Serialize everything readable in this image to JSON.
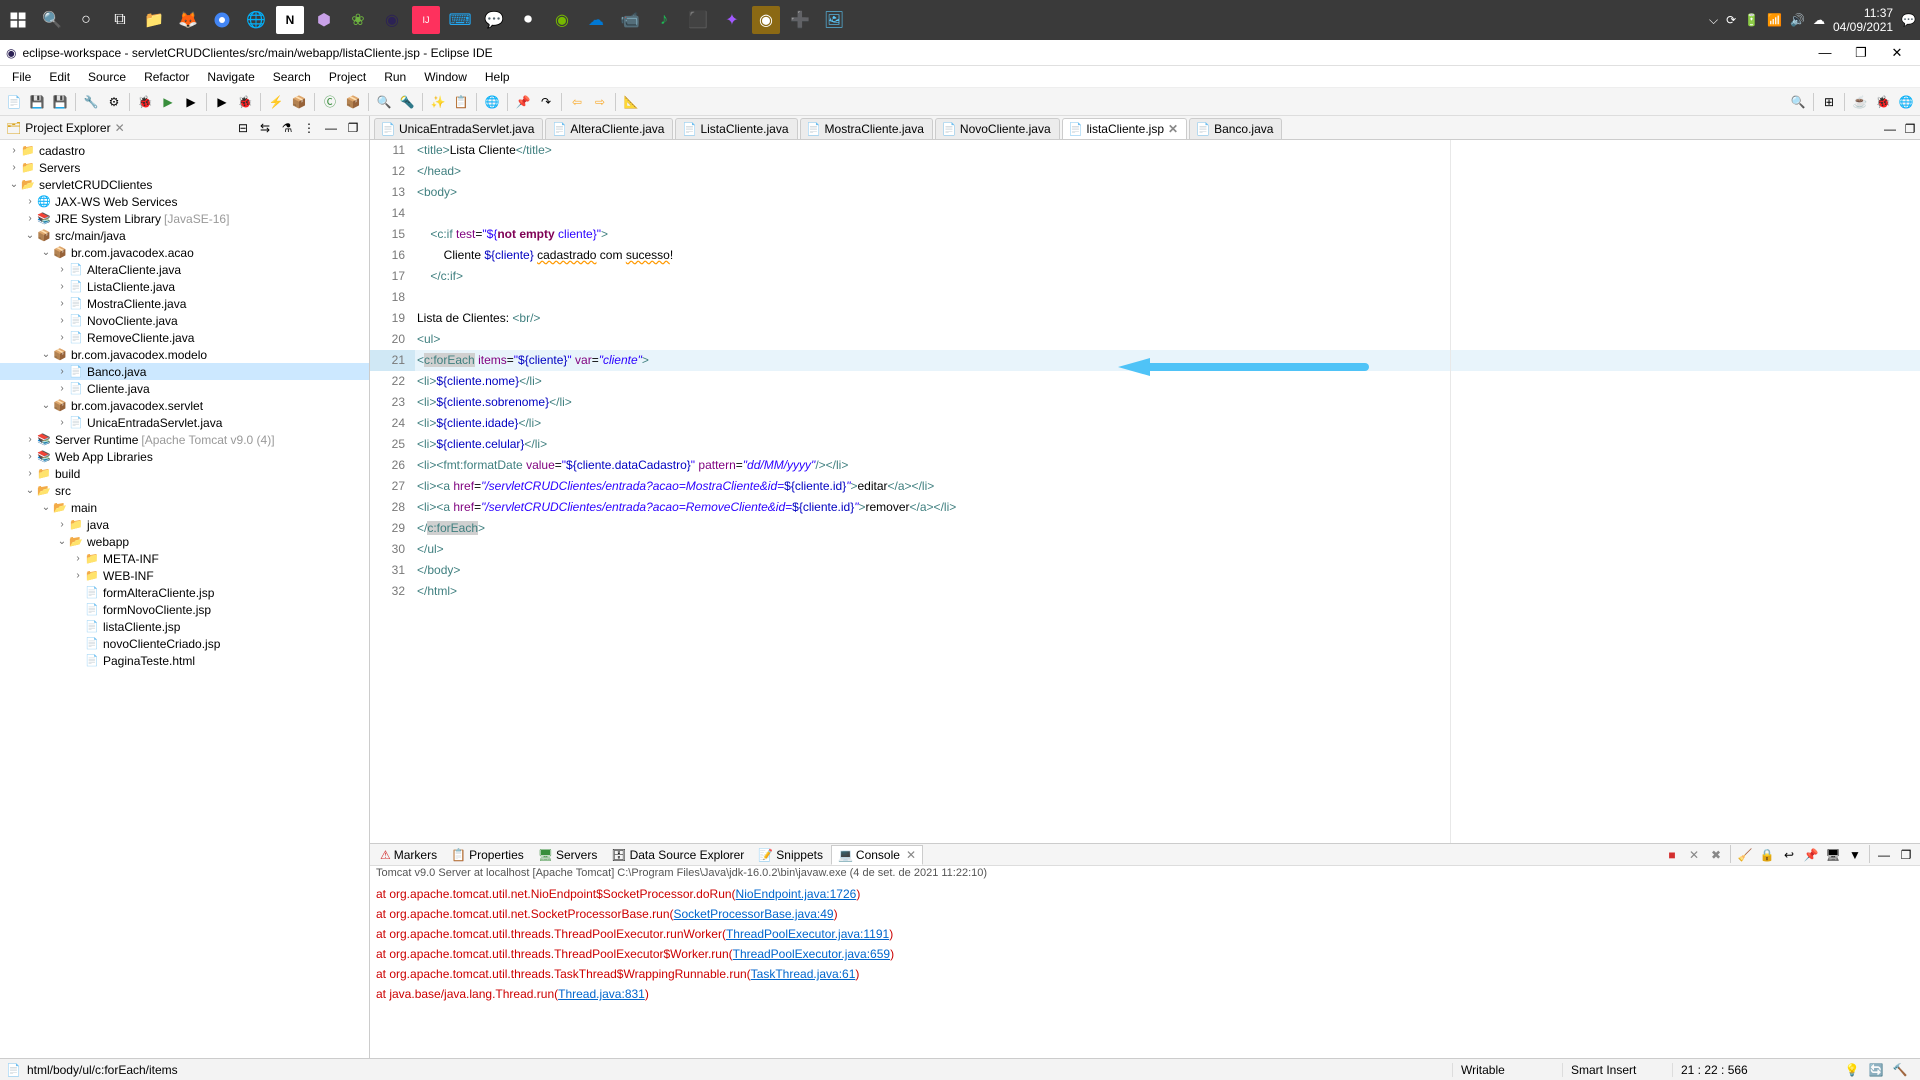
{
  "taskbar": {
    "clock_time": "11:37",
    "clock_date": "04/09/2021"
  },
  "titlebar": {
    "title": "eclipse-workspace - servletCRUDClientes/src/main/webapp/listaCliente.jsp - Eclipse IDE"
  },
  "menu": [
    "File",
    "Edit",
    "Source",
    "Refactor",
    "Navigate",
    "Search",
    "Project",
    "Run",
    "Window",
    "Help"
  ],
  "explorer": {
    "title": "Project Explorer",
    "tree": {
      "cadastro": "cadastro",
      "servers": "Servers",
      "project": "servletCRUDClientes",
      "jaxws": "JAX-WS Web Services",
      "jre": "JRE System Library",
      "jre_ver": "[JavaSE-16]",
      "src_java": "src/main/java",
      "pkg_acao": "br.com.javacodex.acao",
      "altera": "AlteraCliente.java",
      "lista": "ListaCliente.java",
      "mostra": "MostraCliente.java",
      "novo": "NovoCliente.java",
      "remove": "RemoveCliente.java",
      "pkg_modelo": "br.com.javacodex.modelo",
      "banco": "Banco.java",
      "cliente": "Cliente.java",
      "pkg_servlet": "br.com.javacodex.servlet",
      "unica": "UnicaEntradaServlet.java",
      "runtime": "Server Runtime",
      "runtime_ver": "[Apache Tomcat v9.0 (4)]",
      "webapplib": "Web App Libraries",
      "build": "build",
      "src": "src",
      "main": "main",
      "java_f": "java",
      "webapp": "webapp",
      "metainf": "META-INF",
      "webinf": "WEB-INF",
      "formAltera": "formAlteraCliente.jsp",
      "formNovo": "formNovoCliente.jsp",
      "listaJsp": "listaCliente.jsp",
      "novoCriado": "novoClienteCriado.jsp",
      "pagina": "PaginaTeste.html"
    }
  },
  "tabs": [
    {
      "label": "UnicaEntradaServlet.java",
      "active": false
    },
    {
      "label": "AlteraCliente.java",
      "active": false
    },
    {
      "label": "ListaCliente.java",
      "active": false
    },
    {
      "label": "MostraCliente.java",
      "active": false
    },
    {
      "label": "NovoCliente.java",
      "active": false
    },
    {
      "label": "listaCliente.jsp",
      "active": true
    },
    {
      "label": "Banco.java",
      "active": false
    }
  ],
  "code": {
    "l11": {
      "n": "11",
      "t": "<title>Lista Cliente</title>"
    },
    "l12": {
      "n": "12",
      "t": "</head>"
    },
    "l13": {
      "n": "13",
      "t": "<body>"
    },
    "l14": {
      "n": "14",
      "t": ""
    },
    "l15": {
      "n": "15",
      "t": "    <c:if test=\"${not empty cliente}\">"
    },
    "l16": {
      "n": "16",
      "t": "        Cliente ${cliente} cadastrado com sucesso!"
    },
    "l17": {
      "n": "17",
      "t": "    </c:if>"
    },
    "l18": {
      "n": "18",
      "t": ""
    },
    "l19": {
      "n": "19",
      "t": "Lista de Clientes: <br/>"
    },
    "l20": {
      "n": "20",
      "t": "<ul>"
    },
    "l21": {
      "n": "21",
      "t": "<c:forEach items=\"${cliente}\" var=\"cliente\">"
    },
    "l22": {
      "n": "22",
      "t": "<li>${cliente.nome}</li>"
    },
    "l23": {
      "n": "23",
      "t": "<li>${cliente.sobrenome}</li>"
    },
    "l24": {
      "n": "24",
      "t": "<li>${cliente.idade}</li>"
    },
    "l25": {
      "n": "25",
      "t": "<li>${cliente.celular}</li>"
    },
    "l26": {
      "n": "26",
      "t": "<li><fmt:formatDate value=\"${cliente.dataCadastro}\" pattern=\"dd/MM/yyyy\"/></li>"
    },
    "l27": {
      "n": "27",
      "t": "<li><a href=\"/servletCRUDClientes/entrada?acao=MostraCliente&id=${cliente.id}\">editar</a></li>"
    },
    "l28": {
      "n": "28",
      "t": "<li><a href=\"/servletCRUDClientes/entrada?acao=RemoveCliente&id=${cliente.id}\">remover</a></li>"
    },
    "l29": {
      "n": "29",
      "t": "</c:forEach>"
    },
    "l30": {
      "n": "30",
      "t": "</ul>"
    },
    "l31": {
      "n": "31",
      "t": "</body>"
    },
    "l32": {
      "n": "32",
      "t": "</html>"
    }
  },
  "console": {
    "tabs": {
      "markers": "Markers",
      "properties": "Properties",
      "servers": "Servers",
      "dse": "Data Source Explorer",
      "snippets": "Snippets",
      "console": "Console"
    },
    "info": "Tomcat v9.0 Server at localhost [Apache Tomcat] C:\\Program Files\\Java\\jdk-16.0.2\\bin\\javaw.exe (4 de set. de 2021 11:22:10)",
    "lines": [
      {
        "pre": "        at org.apache.tomcat.util.net.NioEndpoint$SocketProcessor.doRun(",
        "link": "NioEndpoint.java:1726",
        "post": ")"
      },
      {
        "pre": "        at org.apache.tomcat.util.net.SocketProcessorBase.run(",
        "link": "SocketProcessorBase.java:49",
        "post": ")"
      },
      {
        "pre": "        at org.apache.tomcat.util.threads.ThreadPoolExecutor.runWorker(",
        "link": "ThreadPoolExecutor.java:1191",
        "post": ")"
      },
      {
        "pre": "        at org.apache.tomcat.util.threads.ThreadPoolExecutor$Worker.run(",
        "link": "ThreadPoolExecutor.java:659",
        "post": ")"
      },
      {
        "pre": "        at org.apache.tomcat.util.threads.TaskThread$WrappingRunnable.run(",
        "link": "TaskThread.java:61",
        "post": ")"
      },
      {
        "pre": "        at java.base/java.lang.Thread.run(",
        "link": "Thread.java:831",
        "post": ")"
      }
    ]
  },
  "status": {
    "path": "html/body/ul/c:forEach/items",
    "writable": "Writable",
    "insert": "Smart Insert",
    "pos": "21 : 22 : 566"
  }
}
